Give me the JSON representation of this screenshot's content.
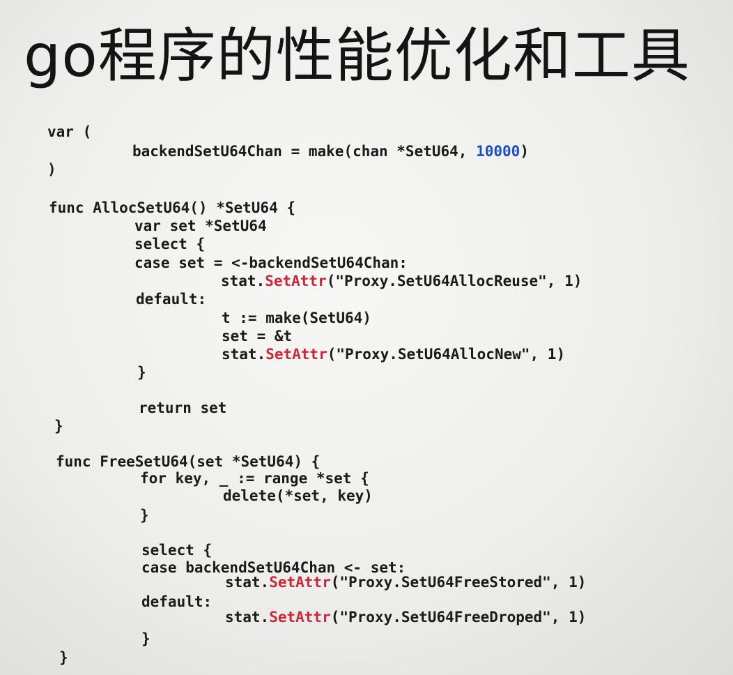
{
  "slide": {
    "title": "go程序的性能优化和工具"
  },
  "code": {
    "lines": [
      {
        "segs": [
          {
            "t": "var (",
            "c": "txt"
          }
        ]
      },
      {
        "segs": [
          {
            "t": "backendSetU64Chan = make(chan *SetU64, ",
            "c": "txt"
          },
          {
            "t": "10000",
            "c": "num"
          },
          {
            "t": ")",
            "c": "txt"
          }
        ]
      },
      {
        "segs": [
          {
            "t": ")",
            "c": "txt"
          }
        ]
      },
      {
        "segs": [
          {
            "t": "func AllocSetU64() *SetU64 {",
            "c": "txt"
          }
        ]
      },
      {
        "segs": [
          {
            "t": "var set *SetU64",
            "c": "txt"
          }
        ]
      },
      {
        "segs": [
          {
            "t": "select {",
            "c": "txt"
          }
        ]
      },
      {
        "segs": [
          {
            "t": "case set = <-backendSetU64Chan:",
            "c": "txt"
          }
        ]
      },
      {
        "segs": [
          {
            "t": "stat.",
            "c": "txt"
          },
          {
            "t": "SetAttr",
            "c": "fn"
          },
          {
            "t": "(\"Proxy.SetU64AllocReuse\", 1)",
            "c": "txt"
          }
        ]
      },
      {
        "segs": [
          {
            "t": "default:",
            "c": "txt"
          }
        ]
      },
      {
        "segs": [
          {
            "t": "t := make(SetU64)",
            "c": "txt"
          }
        ]
      },
      {
        "segs": [
          {
            "t": "set = &t",
            "c": "txt"
          }
        ]
      },
      {
        "segs": [
          {
            "t": "stat.",
            "c": "txt"
          },
          {
            "t": "SetAttr",
            "c": "fn"
          },
          {
            "t": "(\"Proxy.SetU64AllocNew\", 1)",
            "c": "txt"
          }
        ]
      },
      {
        "segs": [
          {
            "t": "}",
            "c": "txt"
          }
        ]
      },
      {
        "segs": [
          {
            "t": "return set",
            "c": "txt"
          }
        ]
      },
      {
        "segs": [
          {
            "t": "}",
            "c": "txt"
          }
        ]
      },
      {
        "segs": [
          {
            "t": "func FreeSetU64(set *SetU64) {",
            "c": "txt"
          }
        ]
      },
      {
        "segs": [
          {
            "t": "for key, _ := range *set {",
            "c": "txt"
          }
        ]
      },
      {
        "segs": [
          {
            "t": "delete(*set, key)",
            "c": "txt"
          }
        ]
      },
      {
        "segs": [
          {
            "t": "}",
            "c": "txt"
          }
        ]
      },
      {
        "segs": [
          {
            "t": "select {",
            "c": "txt"
          }
        ]
      },
      {
        "segs": [
          {
            "t": "case backendSetU64Chan <- set:",
            "c": "txt"
          }
        ]
      },
      {
        "segs": [
          {
            "t": "stat.",
            "c": "txt"
          },
          {
            "t": "SetAttr",
            "c": "fn"
          },
          {
            "t": "(\"Proxy.SetU64FreeStored\", 1)",
            "c": "txt"
          }
        ]
      },
      {
        "segs": [
          {
            "t": "default:",
            "c": "txt"
          }
        ]
      },
      {
        "segs": [
          {
            "t": "stat.",
            "c": "txt"
          },
          {
            "t": "SetAttr",
            "c": "fn"
          },
          {
            "t": "(\"Proxy.SetU64FreeDroped\", 1)",
            "c": "txt"
          }
        ]
      },
      {
        "segs": [
          {
            "t": "}",
            "c": "txt"
          }
        ]
      },
      {
        "segs": [
          {
            "t": "}",
            "c": "txt"
          }
        ]
      }
    ]
  },
  "colors": {
    "function_call": "#c8283a",
    "number_literal": "#1f4fbf",
    "text": "#1a1a1a"
  }
}
